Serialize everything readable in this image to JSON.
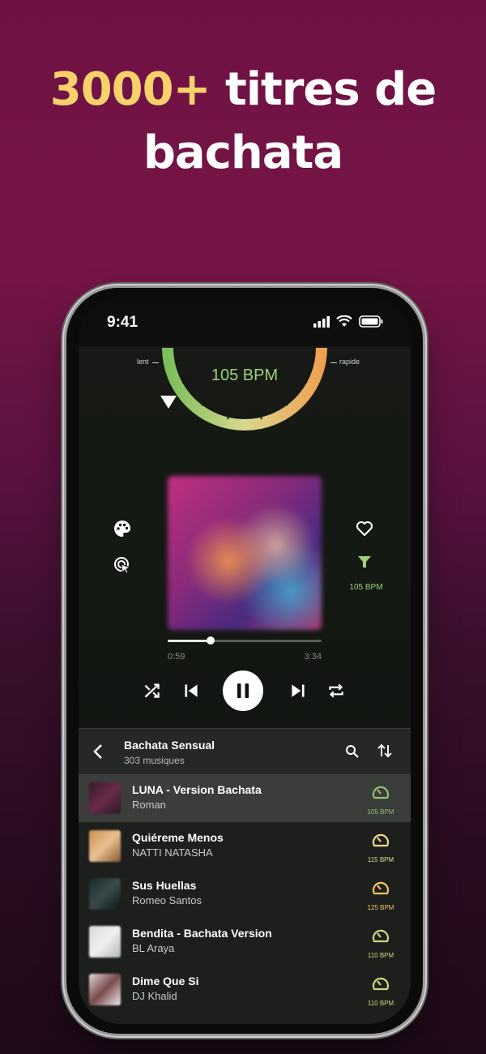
{
  "headline": {
    "accent": "3000+",
    "rest": " titres de bachata"
  },
  "status_bar": {
    "time": "9:41"
  },
  "player": {
    "gauge": {
      "left_label": "lent",
      "right_label": "rapide",
      "bpm_text": "105 BPM"
    },
    "bpm_filter_label": "105 BPM",
    "progress": {
      "elapsed": "0:59",
      "total": "3:34",
      "fraction": 0.28
    },
    "colors": {
      "accent_green": "#9fd078"
    }
  },
  "playlist": {
    "title": "Bachata Sensual",
    "count": "303 musiques",
    "tracks": [
      {
        "title": "LUNA - Version Bachata",
        "artist": "Roman",
        "bpm": "105 BPM",
        "bpm_color": "#8fc070",
        "active": true
      },
      {
        "title": "Quiéreme Menos",
        "artist": "NATTI NATASHA",
        "bpm": "115 BPM",
        "bpm_color": "#e8d890",
        "active": false
      },
      {
        "title": "Sus Huellas",
        "artist": "Romeo Santos",
        "bpm": "125 BPM",
        "bpm_color": "#f0c060",
        "active": false
      },
      {
        "title": "Bendita - Bachata Version",
        "artist": "BL Araya",
        "bpm": "110 BPM",
        "bpm_color": "#c8d880",
        "active": false
      },
      {
        "title": "Dime Que Si",
        "artist": "DJ Khalid",
        "bpm": "110 BPM",
        "bpm_color": "#c8d880",
        "active": false
      }
    ]
  }
}
